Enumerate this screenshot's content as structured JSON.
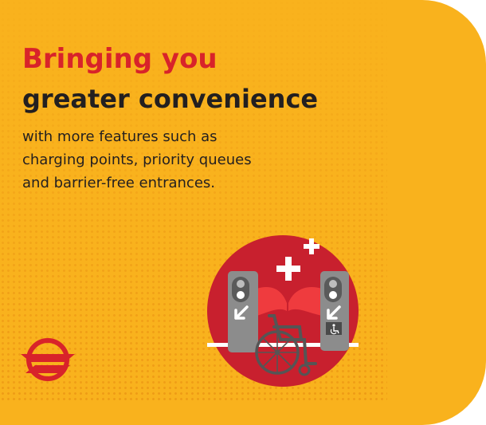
{
  "headline": {
    "line1": "Bringing you",
    "line2": "greater convenience"
  },
  "body": {
    "line1": "with more features such as",
    "line2": "charging points, priority queues",
    "line3": "and barrier-free entrances."
  },
  "icons": {
    "illustration": "wheelchair-fare-gate-illustration",
    "logo": "smrt-logo-icon",
    "plus": "plus-icon",
    "accessibility": "wheelchair-symbol-icon"
  },
  "colors": {
    "background": "#F9B21D",
    "headline_red": "#D8232A",
    "headline_dark": "#231F20",
    "circle": "#C8202E",
    "gate": "#8C8C8C",
    "flap": "#EF3B3E"
  }
}
